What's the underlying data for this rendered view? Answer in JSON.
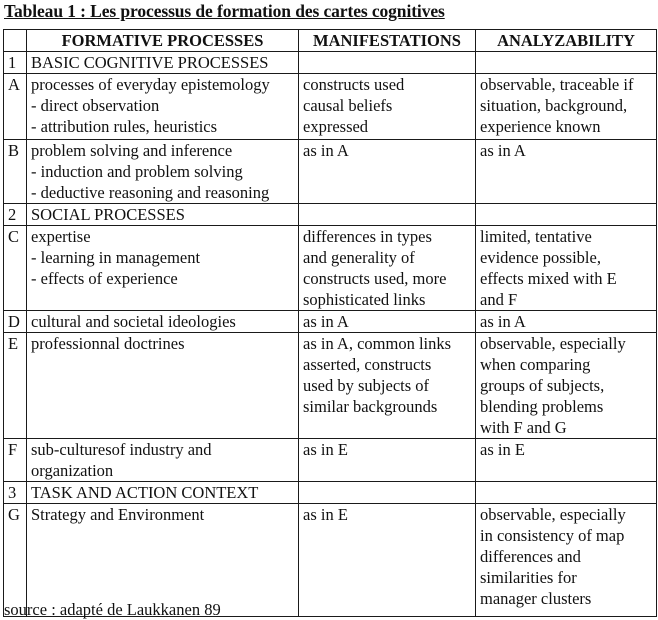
{
  "title": "Tableau 1 : Les processus de formation des cartes cognitives",
  "table": {
    "headers": [
      "",
      "FORMATIVE PROCESSES",
      "MANIFESTATIONS",
      "ANALYZABILITY"
    ],
    "rows": [
      {
        "id": "1",
        "process": [
          "BASIC COGNITIVE PROCESSES"
        ],
        "manifestations": [],
        "analyzability": []
      },
      {
        "id": "A",
        "process": [
          "processes of everyday epistemology",
          "- direct observation",
          "- attribution rules, heuristics"
        ],
        "manifestations": [
          "constructs used",
          "causal beliefs",
          "expressed"
        ],
        "analyzability": [
          "observable, traceable if",
          "situation, background,",
          "experience known"
        ]
      },
      {
        "id": "B",
        "process": [
          "problem solving and inference",
          "- induction and problem solving",
          "- deductive reasoning and reasoning"
        ],
        "manifestations": [
          "as in A"
        ],
        "analyzability": [
          "as in A"
        ]
      },
      {
        "id": "2",
        "process": [
          "SOCIAL PROCESSES"
        ],
        "manifestations": [],
        "analyzability": []
      },
      {
        "id": "C",
        "process": [
          "expertise",
          "- learning in management",
          "- effects of experience"
        ],
        "manifestations": [
          "differences in types",
          "and generality of",
          "constructs used, more",
          "sophisticated links"
        ],
        "analyzability": [
          "limited, tentative",
          "evidence possible,",
          "effects mixed with E",
          "and F"
        ]
      },
      {
        "id": "D",
        "process": [
          "cultural and societal ideologies"
        ],
        "manifestations": [
          "as in A"
        ],
        "analyzability": [
          "as in A"
        ]
      },
      {
        "id": "E",
        "process": [
          "professionnal doctrines"
        ],
        "manifestations": [
          "as in A, common links",
          "asserted, constructs",
          "used by subjects of",
          "similar backgrounds"
        ],
        "analyzability": [
          "observable, especially",
          "when comparing",
          "groups of subjects,",
          "blending problems",
          "with F and G"
        ]
      },
      {
        "id": "F",
        "process": [
          "sub-culturesof industry and",
          "organization"
        ],
        "manifestations": [
          "as in E"
        ],
        "analyzability": [
          "as in E"
        ]
      },
      {
        "id": "3",
        "process": [
          "TASK AND ACTION CONTEXT"
        ],
        "manifestations": [],
        "analyzability": []
      },
      {
        "id": "G",
        "process": [
          "Strategy and Environment"
        ],
        "manifestations": [
          "as in E"
        ],
        "analyzability": [
          "observable, especially",
          "in consistency of map",
          "differences and",
          "similarities for",
          "manager clusters"
        ]
      }
    ]
  },
  "source": "source : adapté de Laukkanen 89"
}
